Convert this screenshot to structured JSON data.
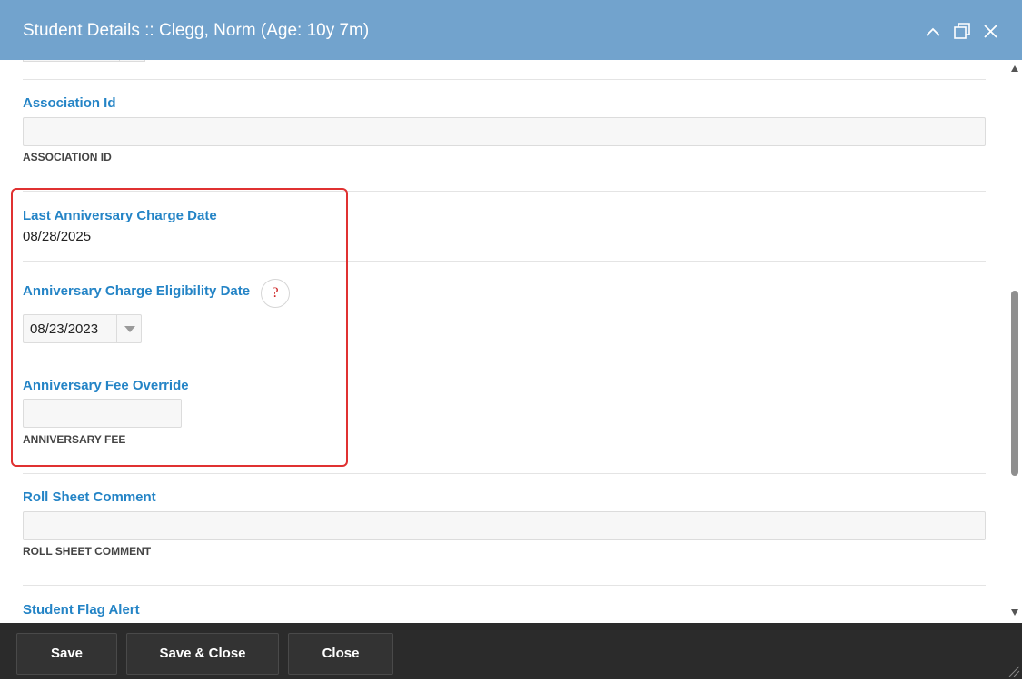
{
  "window": {
    "title": "Student Details :: Clegg, Norm (Age: 10y 7m)",
    "controls": [
      "chevron-up-icon",
      "restore-icon",
      "close-icon"
    ]
  },
  "fields": {
    "association_id": {
      "label": "Association Id",
      "value": "",
      "hint": "ASSOCIATION ID"
    },
    "last_anniversary_charge_date": {
      "label": "Last Anniversary Charge Date",
      "value": "08/28/2025"
    },
    "anniversary_charge_eligibility_date": {
      "label": "Anniversary Charge Eligibility Date",
      "value": "08/23/2023",
      "help_label": "?"
    },
    "anniversary_fee_override": {
      "label": "Anniversary Fee Override",
      "value": "",
      "hint": "ANNIVERSARY FEE"
    },
    "roll_sheet_comment": {
      "label": "Roll Sheet Comment",
      "value": "",
      "hint": "ROLL SHEET COMMENT"
    },
    "student_flag_alert": {
      "label": "Student Flag Alert"
    }
  },
  "footer": {
    "save_label": "Save",
    "save_close_label": "Save & Close",
    "close_label": "Close"
  },
  "colors": {
    "titlebar": "#72a3cd",
    "label": "#2484c6",
    "highlight": "#e03131",
    "footer": "#2b2b2b"
  }
}
